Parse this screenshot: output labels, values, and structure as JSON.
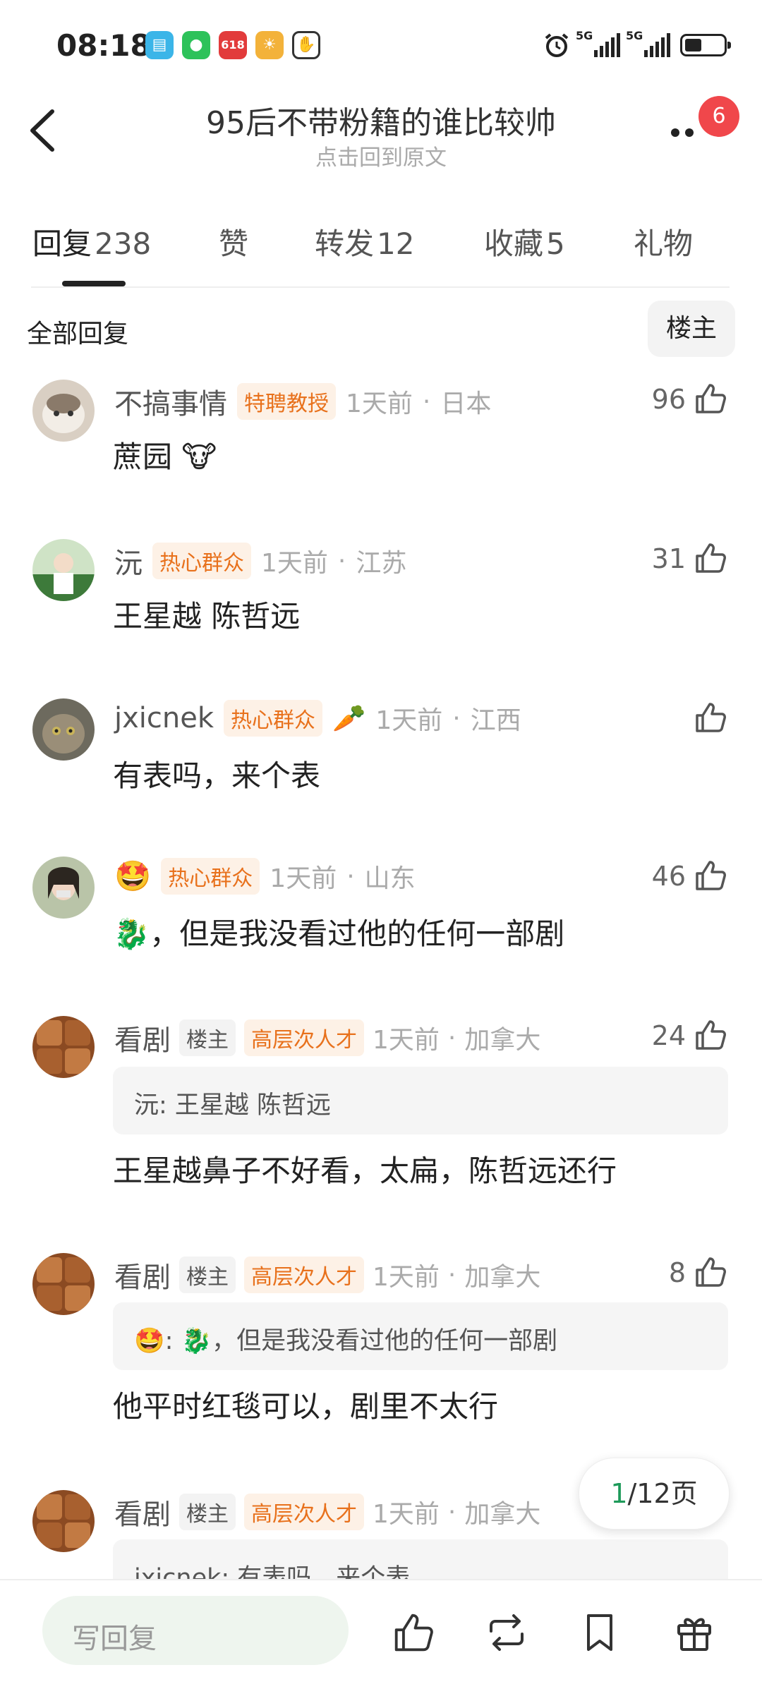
{
  "status_bar": {
    "time": "08:18",
    "app_icons": [
      "reader-app-icon",
      "wechat-icon",
      "shopping-618-icon",
      "weather-icon",
      "hand-icon"
    ],
    "signal_labels": [
      "5G",
      "5G"
    ],
    "battery_level": 0.45
  },
  "header": {
    "title": "95后不带粉籍的谁比较帅",
    "subtitle": "点击回到原文",
    "notification_count": "6"
  },
  "tabs": [
    {
      "label": "回复",
      "count": "238"
    },
    {
      "label": "赞",
      "count": ""
    },
    {
      "label": "转发",
      "count": "12"
    },
    {
      "label": "收藏",
      "count": "5"
    },
    {
      "label": "礼物",
      "count": ""
    }
  ],
  "filter": {
    "all_label": "全部回复",
    "op_label": "楼主"
  },
  "comments": [
    {
      "name": "不搞事情",
      "op_tag": "",
      "badge": "特聘教授",
      "extra": "",
      "time": "1天前",
      "location": "日本",
      "likes": "96",
      "text": "蔗园 🐮",
      "quote": ""
    },
    {
      "name": "沅",
      "op_tag": "",
      "badge": "热心群众",
      "extra": "",
      "time": "1天前",
      "location": "江苏",
      "likes": "31",
      "text": "王星越 陈哲远",
      "quote": ""
    },
    {
      "name": "jxicnek",
      "op_tag": "",
      "badge": "热心群众",
      "extra": "🥕",
      "time": "1天前",
      "location": "江西",
      "likes": "",
      "text": "有表吗，来个表",
      "quote": ""
    },
    {
      "name": "🤩",
      "op_tag": "",
      "badge": "热心群众",
      "extra": "",
      "time": "1天前",
      "location": "山东",
      "likes": "46",
      "text": "🐉，但是我没看过他的任何一部剧",
      "quote": ""
    },
    {
      "name": "看剧",
      "op_tag": "楼主",
      "badge": "高层次人才",
      "extra": "",
      "time": "1天前",
      "location": "加拿大",
      "likes": "24",
      "text": "王星越鼻子不好看，太扁，陈哲远还行",
      "quote": "沅: 王星越 陈哲远"
    },
    {
      "name": "看剧",
      "op_tag": "楼主",
      "badge": "高层次人才",
      "extra": "",
      "time": "1天前",
      "location": "加拿大",
      "likes": "8",
      "text": "他平时红毯可以，剧里不太行",
      "quote": "🤩: 🐉，但是我没看过他的任何一部剧"
    },
    {
      "name": "看剧",
      "op_tag": "楼主",
      "badge": "高层次人才",
      "extra": "",
      "time": "1天前",
      "location": "加拿大",
      "likes": "",
      "text": "",
      "quote": "jxicnek: 有表吗，来个表"
    }
  ],
  "pager": {
    "current": "1",
    "total_label": "/12页"
  },
  "bottom_bar": {
    "reply_placeholder": "写回复"
  }
}
